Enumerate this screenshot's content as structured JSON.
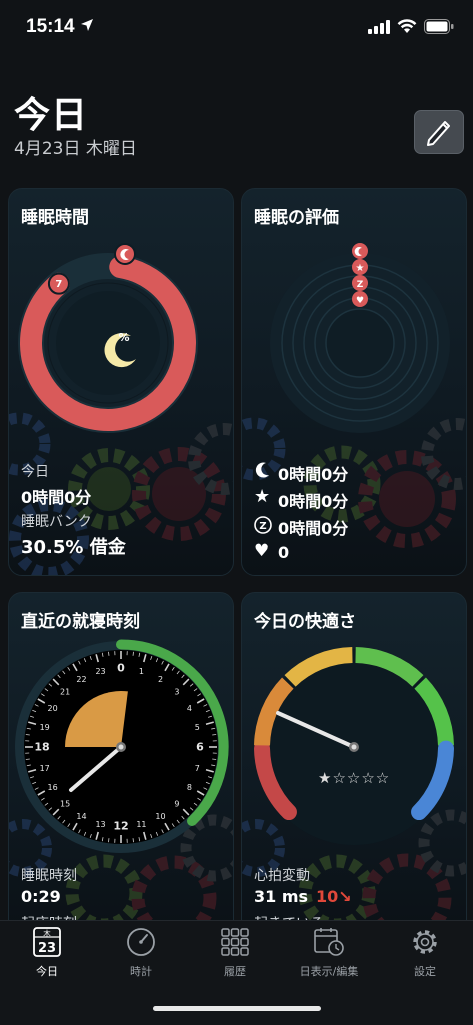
{
  "status": {
    "time": "15:14"
  },
  "header": {
    "title": "今日",
    "date": "4月23日 木曜日"
  },
  "cards": {
    "sleep_time": {
      "title": "睡眠時間",
      "center_symbol": "%",
      "badge_start": "7",
      "progress_fraction": 0.89,
      "today_label": "今日",
      "today_value": "0時間0分",
      "bank_label": "睡眠バンク",
      "bank_value": "30.5% 借金"
    },
    "sleep_rating": {
      "title": "睡眠の評価",
      "rows": [
        {
          "icon": "moon-icon",
          "value": "0時間0分"
        },
        {
          "icon": "star-icon",
          "value": "0時間0分"
        },
        {
          "icon": "z-icon",
          "value": "0時間0分"
        },
        {
          "icon": "heart-icon",
          "value": "0"
        }
      ],
      "badge_z": "Z"
    },
    "bedtime": {
      "title": "直近の就寝時刻",
      "clock_numbers": [
        "0",
        "1",
        "2",
        "3",
        "4",
        "5",
        "6",
        "7",
        "8",
        "9",
        "10",
        "11",
        "12",
        "13",
        "14",
        "15",
        "16",
        "17",
        "18",
        "19",
        "20",
        "21",
        "22",
        "23"
      ],
      "bold_numbers": [
        "0",
        "6",
        "12",
        "18"
      ],
      "bed_label": "睡眠時刻",
      "bed_value": "0:29",
      "wake_label": "起床時刻"
    },
    "comfort": {
      "title": "今日の快適さ",
      "stars_filled": 1,
      "stars_total": 5,
      "stars_text": "★☆☆☆☆",
      "hrv_label": "心拍変動",
      "hrv_value": "31 ms",
      "hrv_delta": "10↘",
      "state_label": "起きている"
    }
  },
  "tabs": [
    {
      "id": "today",
      "label": "今日",
      "icon_top": "木",
      "icon_num": "23",
      "active": true
    },
    {
      "id": "clock",
      "label": "時計"
    },
    {
      "id": "history",
      "label": "履歴"
    },
    {
      "id": "day",
      "label": "日表示/編集"
    },
    {
      "id": "settings",
      "label": "設定"
    }
  ],
  "colors": {
    "accent_red": "#d95a5a",
    "clock_green": "#4aa84a",
    "sleep_orange": "#d99a45"
  }
}
